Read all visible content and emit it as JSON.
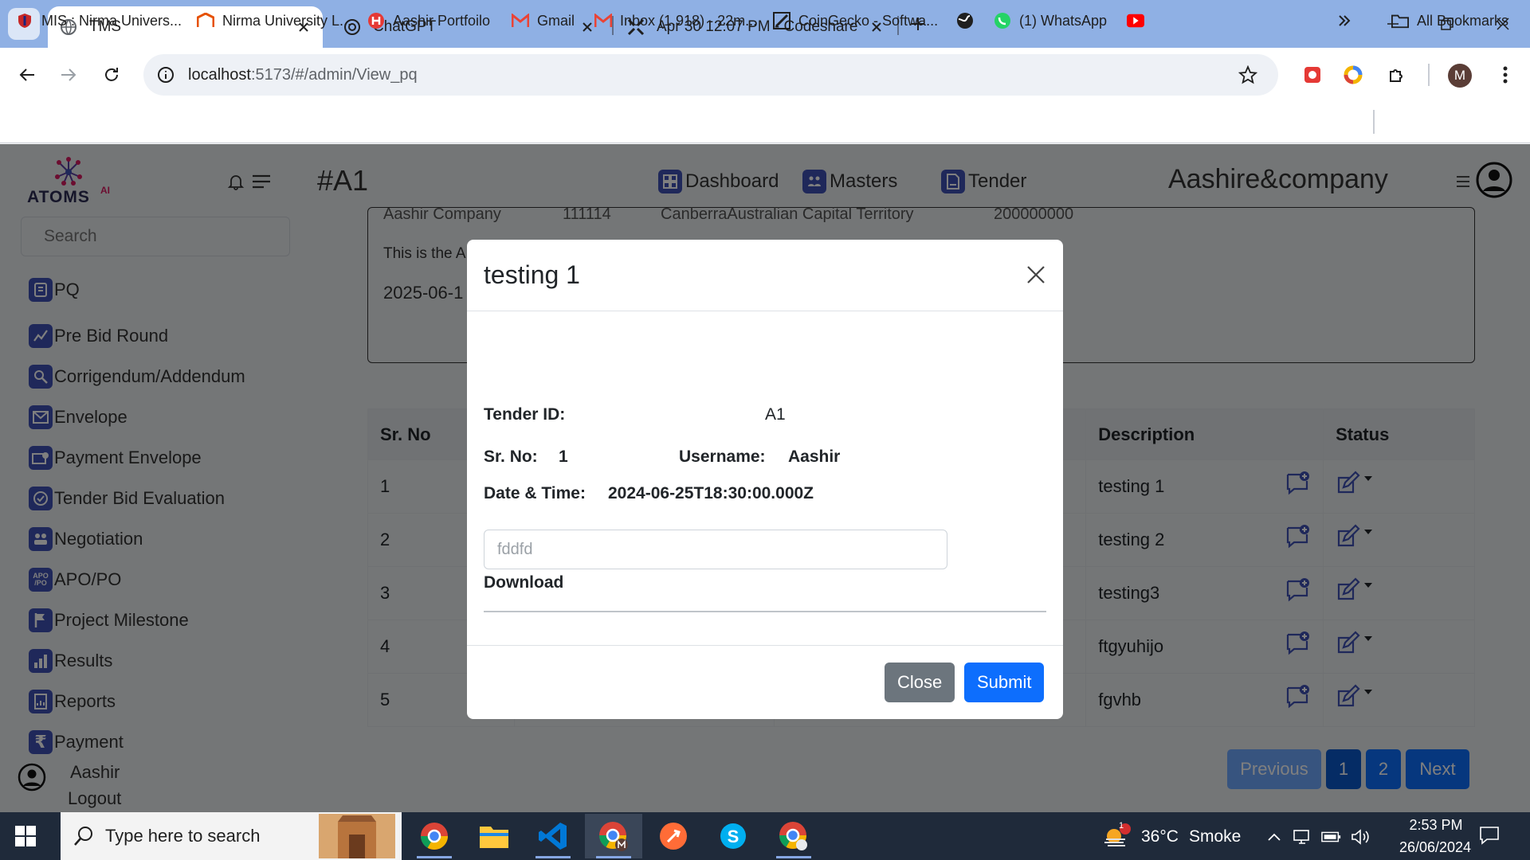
{
  "browser": {
    "tabs": [
      {
        "title": "TMS",
        "active": true
      },
      {
        "title": "ChatGPT",
        "active": false
      },
      {
        "title": "Apr 30 12:07 PM - Codeshare",
        "active": false
      }
    ],
    "url_host": "localhost",
    "url_path": ":5173/#/admin/View_pq",
    "profile_initial": "M",
    "bookmarks": [
      {
        "label": "MIS : Nirma Univers...",
        "icon": "shield-logo-icon"
      },
      {
        "label": "Nirma University L...",
        "icon": "nirma-logo-icon"
      },
      {
        "label": "Aashir Portfoilo",
        "icon": "portfolio-logo-icon"
      },
      {
        "label": "Gmail",
        "icon": "gmail-icon"
      },
      {
        "label": "Inbox (1,918) - 22m...",
        "icon": "gmail-icon"
      },
      {
        "label": "CoinGecko - Softwa...",
        "icon": "coingecko-icon"
      },
      {
        "label": "",
        "icon": "globe-icon"
      },
      {
        "label": "(1) WhatsApp",
        "icon": "whatsapp-icon"
      },
      {
        "label": "",
        "icon": "youtube-icon"
      }
    ],
    "all_bookmarks": "All Bookmarks"
  },
  "app": {
    "logo_text": "ATOMS",
    "logo_sup": "AI",
    "page_heading": "#A1",
    "nav": [
      {
        "label": "Dashboard",
        "icon": "dashboard-icon"
      },
      {
        "label": "Masters",
        "icon": "masters-icon"
      },
      {
        "label": "Tender",
        "icon": "tender-icon"
      }
    ],
    "company": "Aashire&company",
    "search_placeholder": "Search",
    "sidebar": [
      {
        "label": "PQ",
        "icon": "pq-icon"
      },
      {
        "label": "Pre Bid Round",
        "icon": "chart-line-icon"
      },
      {
        "label": "Corrigendum/Addendum",
        "icon": "corrigendum-icon"
      },
      {
        "label": "Envelope",
        "icon": "envelope-icon"
      },
      {
        "label": "Payment Envelope",
        "icon": "payment-envelope-icon"
      },
      {
        "label": "Tender Bid Evaluation",
        "icon": "evaluation-icon"
      },
      {
        "label": "Negotiation",
        "icon": "negotiation-icon"
      },
      {
        "label": "APO/PO",
        "icon": "apo-po-icon"
      },
      {
        "label": "Project Milestone",
        "icon": "milestone-flag-icon"
      },
      {
        "label": "Results",
        "icon": "results-bar-icon"
      },
      {
        "label": "Reports",
        "icon": "reports-icon"
      },
      {
        "label": "Payment",
        "icon": "rupee-icon"
      }
    ],
    "user_name": "Aashir",
    "logout": "Logout"
  },
  "card": {
    "row_company": "Aashir Company",
    "row_code": "111114",
    "row_location": "CanberraAustralian Capital Territory",
    "row_amount": "200000000",
    "note": "This is the A",
    "date": "2025-06-1"
  },
  "table": {
    "headers": {
      "sr_no": "Sr. No",
      "description": "Description",
      "status": "Status"
    },
    "rows": [
      {
        "sr": "1",
        "description": "testing 1"
      },
      {
        "sr": "2",
        "description": "testing 2"
      },
      {
        "sr": "3",
        "description": "testing3"
      },
      {
        "sr": "4",
        "description": "ftgyuhijo"
      },
      {
        "sr": "5",
        "description": "fgvhb"
      }
    ]
  },
  "pagination": {
    "previous": "Previous",
    "page1": "1",
    "page2": "2",
    "next": "Next"
  },
  "modal": {
    "title": "testing 1",
    "tender_id_label": "Tender ID:",
    "tender_id": "A1",
    "sr_no_label": "Sr. No:",
    "sr_no": "1",
    "username_label": "Username:",
    "username": "Aashir",
    "datetime_label": "Date & Time:",
    "datetime": "2024-06-25T18:30:00.000Z",
    "input_placeholder": "fddfd",
    "download": "Download",
    "close": "Close",
    "submit": "Submit"
  },
  "taskbar": {
    "search_placeholder": "Type here to search",
    "temperature": "36°C",
    "weather": "Smoke",
    "weather_badge": "1",
    "time": "2:53 PM",
    "date": "26/06/2024"
  },
  "colors": {
    "accent_blue": "#0d6efd",
    "pagination_active": "#0a58ca",
    "icon_indigo": "#3f51b5"
  }
}
